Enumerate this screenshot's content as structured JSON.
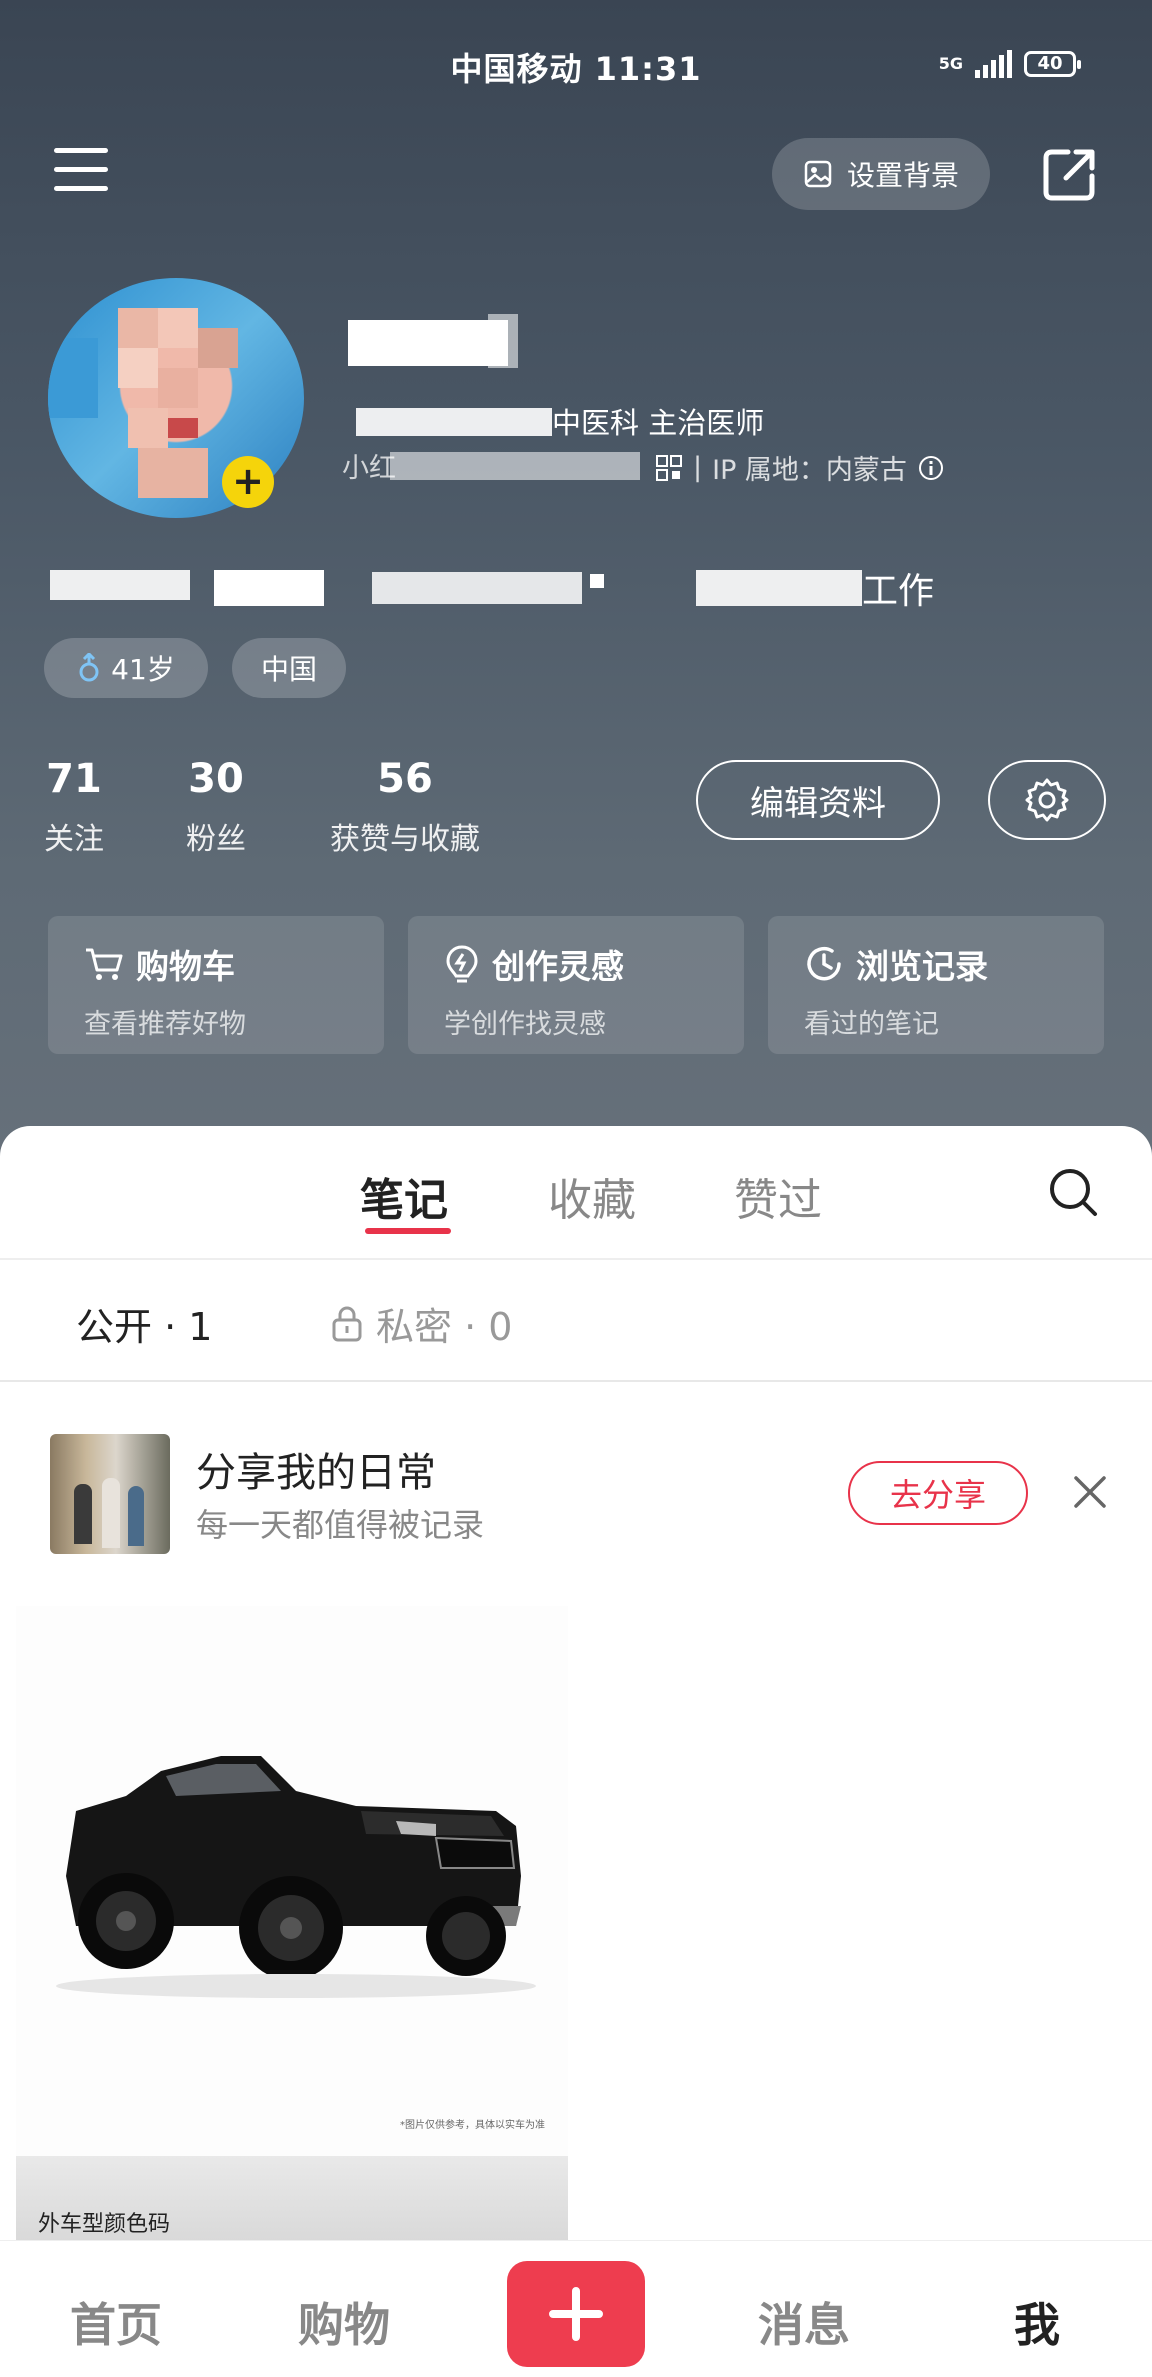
{
  "status_bar": {
    "carrier_time": "中国移动 11:31",
    "network": "5G",
    "battery": "40"
  },
  "header": {
    "set_background_label": "设置背景"
  },
  "profile": {
    "title": "中医科 主治医师",
    "id_prefix": "小红",
    "ip_location": "IP 属地：内蒙古",
    "bio_tail": "工作",
    "tags": [
      {
        "label": "41岁",
        "icon": "male-icon"
      },
      {
        "label": "中国"
      }
    ]
  },
  "stats": [
    {
      "value": "71",
      "label": "关注"
    },
    {
      "value": "30",
      "label": "粉丝"
    },
    {
      "value": "56",
      "label": "获赞与收藏"
    }
  ],
  "edit_profile_label": "编辑资料",
  "quick_cards": [
    {
      "title": "购物车",
      "subtitle": "查看推荐好物",
      "icon": "cart-icon"
    },
    {
      "title": "创作灵感",
      "subtitle": "学创作找灵感",
      "icon": "bulb-icon"
    },
    {
      "title": "浏览记录",
      "subtitle": "看过的笔记",
      "icon": "clock-icon"
    }
  ],
  "tabs": [
    {
      "label": "笔记",
      "active": true
    },
    {
      "label": "收藏"
    },
    {
      "label": "赞过"
    }
  ],
  "sub_filter": {
    "public": "公开 · 1",
    "private": "私密 · 0"
  },
  "share_prompt": {
    "title": "分享我的日常",
    "subtitle": "每一天都值得被记录",
    "button": "去分享"
  },
  "note": {
    "caption": "外车型颜色码",
    "fine_print": "*图片仅供参考，具体以实车为准"
  },
  "bottom_nav": [
    {
      "label": "首页"
    },
    {
      "label": "购物"
    },
    {
      "label": "消息"
    },
    {
      "label": "我",
      "active": true
    }
  ],
  "colors": {
    "accent": "#e8334a",
    "plus_button": "#ee3d4f",
    "avatar_badge": "#f5d40b"
  }
}
